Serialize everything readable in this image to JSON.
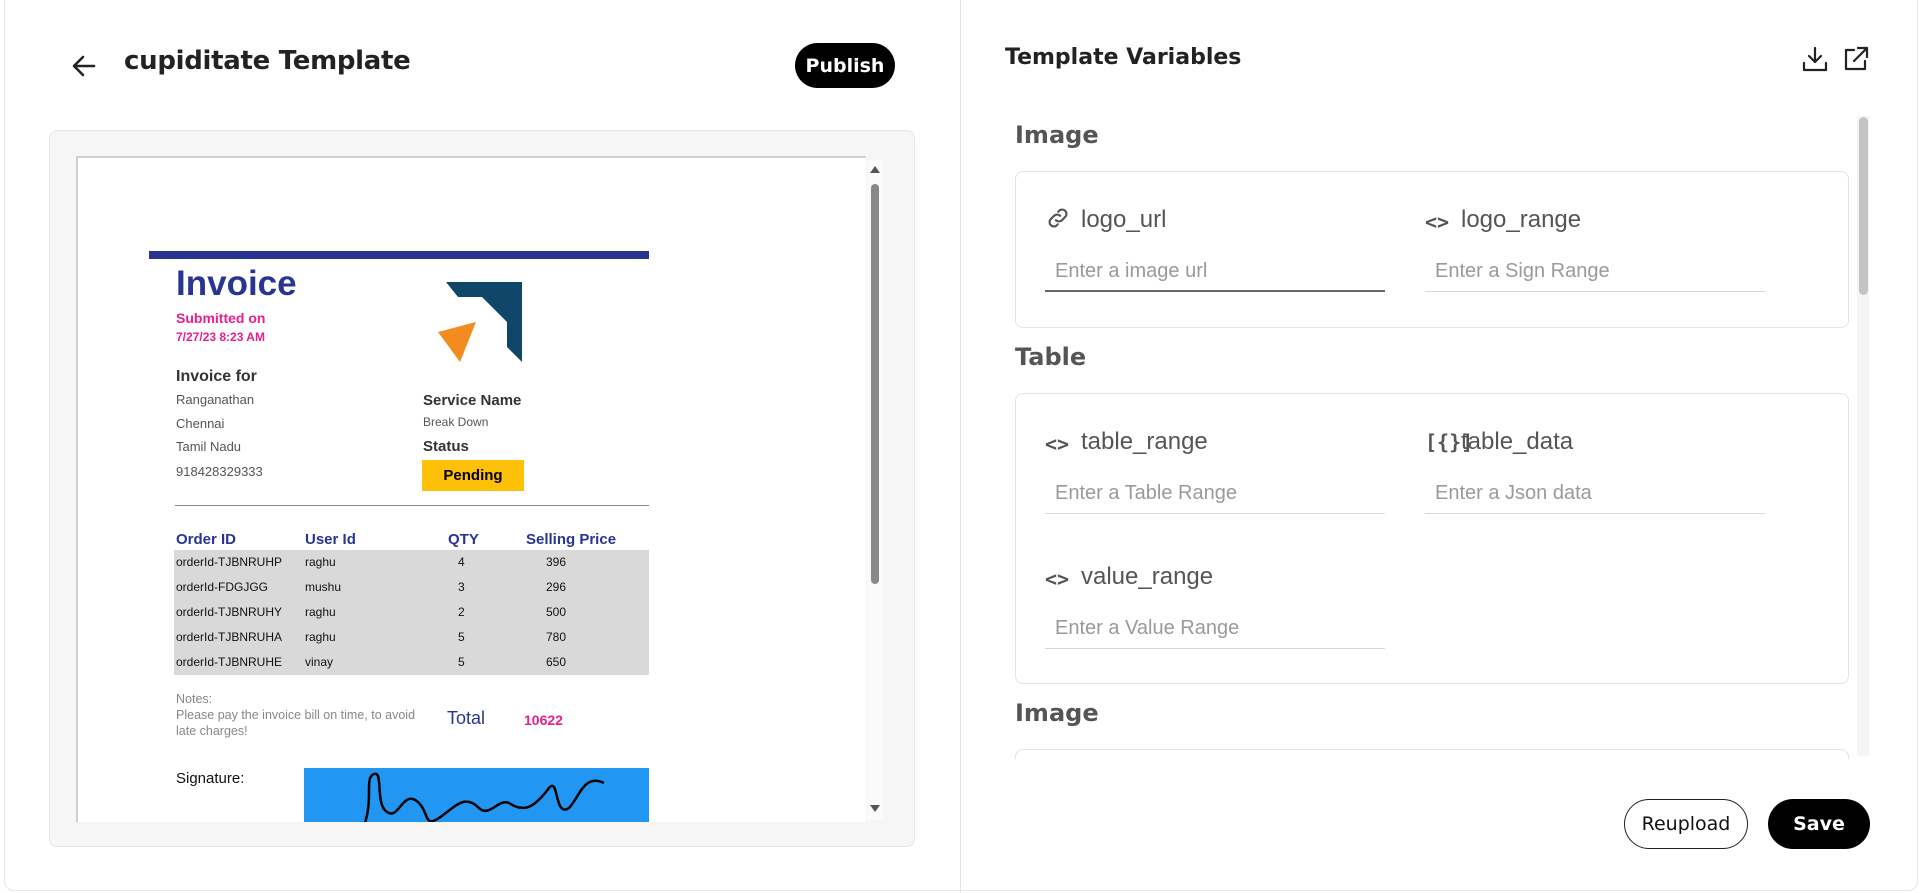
{
  "header": {
    "title": "cupiditate Template",
    "publish_label": "Publish",
    "back_icon": "arrow-left-icon"
  },
  "invoice": {
    "title": "Invoice",
    "submitted_label": "Submitted on",
    "submitted_date": "7/27/23 8:23 AM",
    "invoice_for_label": "Invoice for",
    "customer": {
      "name": "Ranganathan",
      "city": "Chennai",
      "state": "Tamil Nadu",
      "phone": "918428329333"
    },
    "service_name_label": "Service Name",
    "service_name": "Break Down",
    "status_label": "Status",
    "status": "Pending",
    "columns": [
      "Order ID",
      "User Id",
      "QTY",
      "Selling Price"
    ],
    "rows": [
      [
        "orderId-TJBNRUHP",
        "raghu",
        "4",
        "396"
      ],
      [
        "orderId-FDGJGG",
        "mushu",
        "3",
        "296"
      ],
      [
        "orderId-TJBNRUHY",
        "raghu",
        "2",
        "500"
      ],
      [
        "orderId-TJBNRUHA",
        "raghu",
        "5",
        "780"
      ],
      [
        "orderId-TJBNRUHE",
        "vinay",
        "5",
        "650"
      ]
    ],
    "notes_label": "Notes:",
    "notes_text": "Please pay the invoice bill on time, to avoid late charges!",
    "total_label": "Total",
    "total_value": "10622",
    "signature_label": "Signature:",
    "colors": {
      "brand_blue": "#283593",
      "accent_pink": "#e91e8c",
      "status_yellow": "#ffc107",
      "signature_bg": "#2196f3"
    }
  },
  "variables": {
    "title": "Template Variables",
    "download_icon": "download-icon",
    "open_external_icon": "external-link-icon",
    "sections": [
      {
        "title": "Image",
        "fields": [
          {
            "icon": "link-icon",
            "label": "logo_url",
            "placeholder": "Enter a image url"
          },
          {
            "icon": "code-icon",
            "label": "logo_range",
            "placeholder": "Enter a Sign Range"
          }
        ]
      },
      {
        "title": "Table",
        "fields": [
          {
            "icon": "code-icon",
            "label": "table_range",
            "placeholder": "Enter a Table Range"
          },
          {
            "icon": "json-icon",
            "label": "table_data",
            "placeholder": "Enter a Json data"
          },
          {
            "icon": "code-icon",
            "label": "value_range",
            "placeholder": "Enter a Value Range"
          }
        ]
      },
      {
        "title": "Image"
      }
    ]
  },
  "footer": {
    "reupload_label": "Reupload",
    "save_label": "Save"
  }
}
